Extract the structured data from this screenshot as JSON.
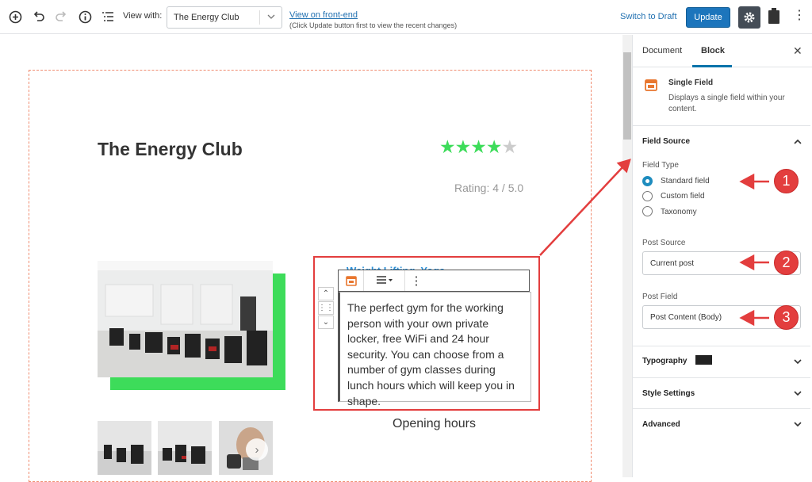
{
  "toolbar": {
    "view_with_label": "View with:",
    "view_with_value": "The Energy Club",
    "front_end_link": "View on front-end",
    "front_end_note": "(Click Update button first to view the recent changes)",
    "switch_draft": "Switch to Draft",
    "update": "Update"
  },
  "content": {
    "title": "The Energy Club",
    "stars": "★★★★",
    "star_empty": "★",
    "rating_value": 4,
    "rating_max": 5,
    "rating_text": "Rating: 4 / 5.0",
    "heading": "Weight Lifting, Yoga",
    "body": "The perfect gym for the working person with your own private locker, free WiFi and 24 hour security. You can choose from a number of gym classes during lunch hours which will keep you in shape.",
    "opening_hours": "Opening hours"
  },
  "sidebar": {
    "tabs": [
      "Document",
      "Block"
    ],
    "active_tab": "Block",
    "block_name": "Single Field",
    "block_desc": "Displays a single field within your content.",
    "field_source_title": "Field Source",
    "field_type_label": "Field Type",
    "field_types": [
      "Standard field",
      "Custom field",
      "Taxonomy"
    ],
    "field_type_selected": "Standard field",
    "post_source_label": "Post Source",
    "post_source_value": "Current post",
    "post_field_label": "Post Field",
    "post_field_value": "Post Content (Body)",
    "typography": "Typography",
    "style_settings": "Style Settings",
    "advanced": "Advanced"
  },
  "annotations": [
    "1",
    "2",
    "3"
  ],
  "colors": {
    "accent": "#1c75bc",
    "star": "#3ddc5a",
    "annotation": "#e33e3e",
    "link": "#2271b1"
  }
}
